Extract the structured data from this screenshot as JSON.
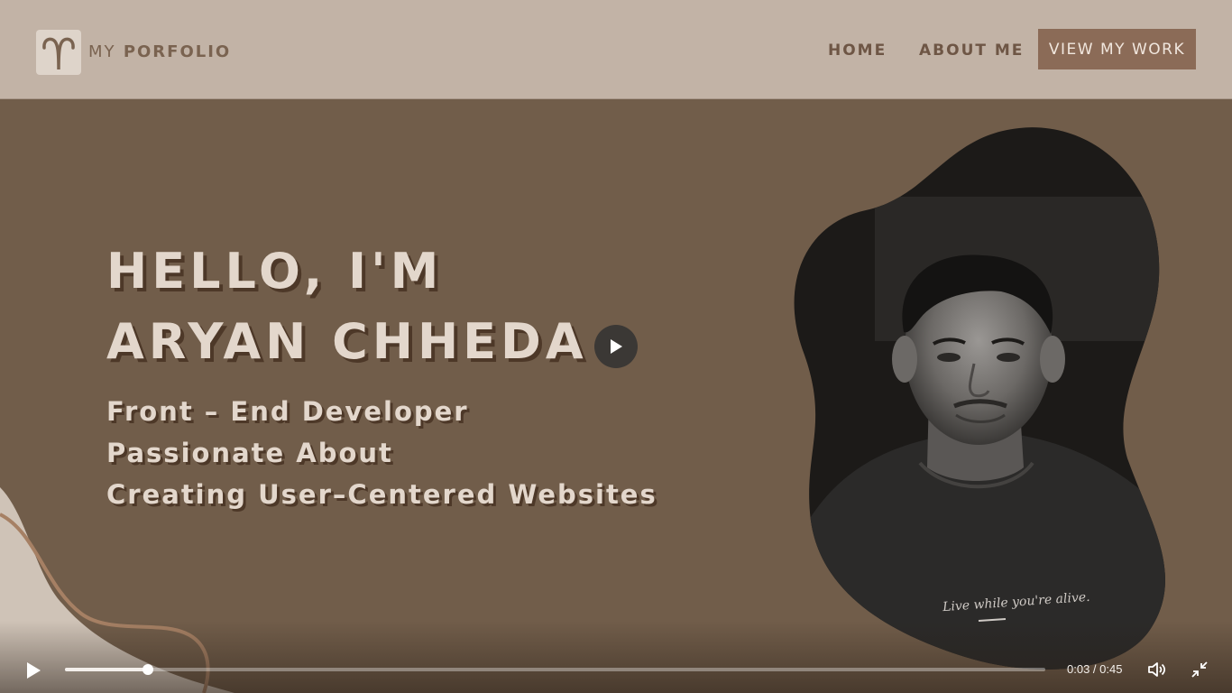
{
  "header": {
    "brand_prefix": "MY",
    "brand_name": "PORFOLIO",
    "nav": {
      "home": "HOME",
      "about": "ABOUT ME",
      "cta": "VIEW MY WORK"
    }
  },
  "hero": {
    "title_line1": "HELLO, I'M",
    "title_line2": "ARYAN CHHEDA",
    "sub_line1": "Front – End Developer",
    "sub_line2": "Passionate About",
    "sub_line3": "Creating User–Centered Websites",
    "shirt_text": "Live while you're alive."
  },
  "video": {
    "time_display": "0:03 / 0:45",
    "progress_fraction": 0.085
  },
  "colors": {
    "header_bg": "#c2b3a6",
    "hero_bg": "#715d4a",
    "cta_bg": "#8b6b57",
    "text_light": "#e3d7cc",
    "text_shadow": "#4d3828"
  },
  "icons": {
    "logo": "aries-symbol-icon",
    "center_play": "play-icon",
    "control_play": "play-icon",
    "volume": "volume-icon",
    "fullscreen": "exit-fullscreen-icon"
  }
}
